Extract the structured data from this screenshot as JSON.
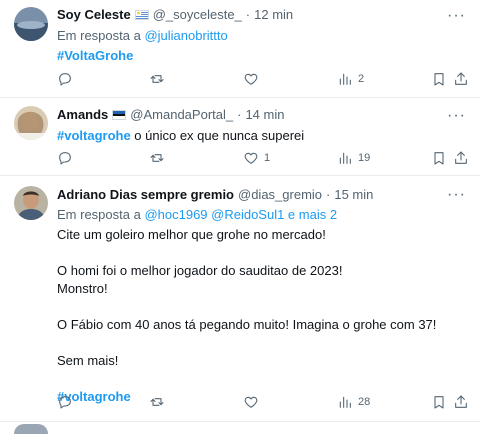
{
  "tweets": [
    {
      "name": "Soy Celeste",
      "flag": "uruguay-flag",
      "handle": "@_soyceleste_",
      "sep": "·",
      "time": "12 min",
      "reply_prefix": "Em resposta a",
      "reply_to": "@julianobrittto",
      "hashtag": "#VoltaGrohe",
      "counts": {
        "reply": "",
        "retweet": "",
        "like": "",
        "views": "2"
      }
    },
    {
      "name": "Amands",
      "flag": "estonia-flag",
      "handle": "@AmandaPortal_",
      "sep": "·",
      "time": "14 min",
      "hashtag": "#voltagrohe",
      "text_after_hashtag": " o único ex que nunca superei",
      "counts": {
        "reply": "",
        "retweet": "",
        "like": "1",
        "views": "19"
      }
    },
    {
      "name": "Adriano Dias sempre gremio",
      "handle": "@dias_gremio",
      "sep": "·",
      "time": "15 min",
      "reply_prefix": "Em resposta a",
      "reply_to": "@hoc1969 @ReidoSul1 e mais 2",
      "lines": [
        "Cite um goleiro melhor que grohe no mercado!",
        "O homi foi o melhor jogador do sauditao de 2023!",
        "Monstro!",
        "O Fábio com 40 anos tá pegando muito! Imagina o grohe com 37!",
        "Sem mais!"
      ],
      "hashtag": "#voltagrohe",
      "counts": {
        "reply": "",
        "retweet": "",
        "like": "",
        "views": "28"
      }
    }
  ],
  "icons": {
    "more": "more-icon",
    "reply": "reply-icon",
    "retweet": "retweet-icon",
    "like": "heart-icon",
    "views": "views-icon",
    "bookmark": "bookmark-icon",
    "share": "share-icon"
  },
  "colors": {
    "link": "#1d9bf0",
    "muted": "#536471",
    "text": "#0f1419",
    "divider": "#e6ecf0"
  },
  "more_glyph": "···"
}
